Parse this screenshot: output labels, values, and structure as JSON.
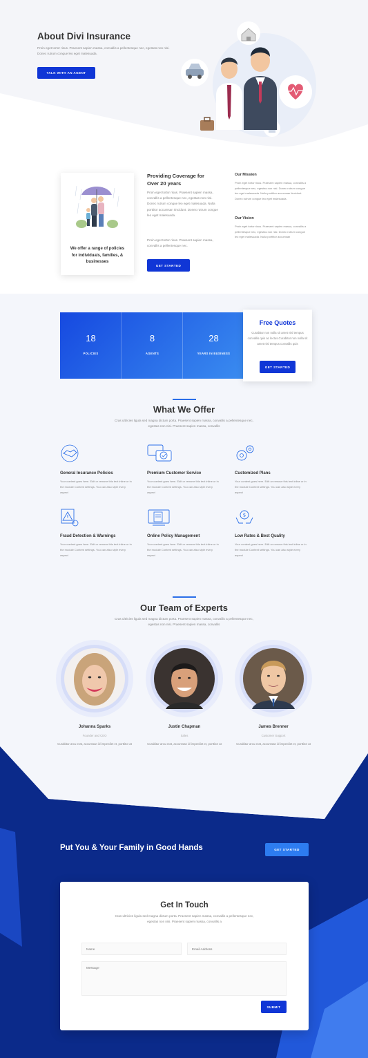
{
  "hero": {
    "title": "About Divi Insurance",
    "text": "Proin eget tortor risus. Praesent sapien massa, convallis a pellentesque nec, egestas non nisi. Donec rutrum congue leo eget malesuada.",
    "cta": "TALK WITH AN AGENT"
  },
  "coverage": {
    "card_text": "We offer a range of policies for individuals, families, & businesses",
    "title": "Providing Coverage for Over 20 years",
    "para1": "Proin eget tortor risus. Praesent sapien massa, convallis a pellentesque nec, egestas non nisi. Donec rutrum congue leo eget malesuada. Nulla porttitor accumsan tincidunt. Donec rutrum congue leo eget malesuada.",
    "para2": "Proin eget tortor risus. Praesent sapien massa, convallis a pellentesque nec.",
    "cta": "GET STARTED",
    "mission_title": "Our Mission",
    "mission_text": "Proin eget tortor risus. Praesent sapien massa, convallis a pellentesque nec, egestas non nisi. Donec rutrum congue leo eget malesuada. Nulla porttitor accumsan tincidunt. Donec rutrum congue leo eget malesuada.",
    "vision_title": "Our Vision",
    "vision_text": "Proin eget tortor risus. Praesent sapien massa, convallis a pellentesque nec, egestas non nisi. Donec rutrum congue leo eget malesuada. Nulla porttitor accumsan"
  },
  "stats": [
    {
      "value": "18",
      "label": "POLICIES"
    },
    {
      "value": "8",
      "label": "AGENTS"
    },
    {
      "value": "28",
      "label": "YEARS IN BUSINESS"
    }
  ],
  "quotes": {
    "title": "Free Quotes",
    "text": "Curabitur non nulla sit amet nisl tempus convallis quis ac lectus.Curabitur non nulla sit amet nisl tempus convallis quis",
    "cta": "GET STARTED"
  },
  "offer": {
    "title": "What We Offer",
    "subtitle": "Cras ultricies ligula sed magna dictum porta. Praesent sapien massa, convallis a pellentesque nec, egestas non nisi. Praesent sapien massa, convallis",
    "items": [
      {
        "title": "General Insurance Policies",
        "text": "Your content goes here. Edit or remove this text inline or in the module Content settings. You can also style every aspect",
        "icon": "handshake-icon"
      },
      {
        "title": "Premium Customer Service",
        "text": "Your content goes here. Edit or remove this text inline or in the module Content settings. You can also style every aspect",
        "icon": "chat-icon"
      },
      {
        "title": "Customized Plans",
        "text": "Your content goes here. Edit or remove this text inline or in the module Content settings. You can also style every aspect",
        "icon": "gears-icon"
      },
      {
        "title": "Fraud Detection & Warnings",
        "text": "Your content goes here. Edit or remove this text inline or in the module Content settings. You can also style every aspect",
        "icon": "warning-icon"
      },
      {
        "title": "Online Policy Management",
        "text": "Your content goes here. Edit or remove this text inline or in the module Content settings. You can also style every aspect",
        "icon": "monitor-icon"
      },
      {
        "title": "Low Rates & Best Quality",
        "text": "Your content goes here. Edit or remove this text inline or in the module Content settings. You can also style every aspect",
        "icon": "money-hands-icon"
      }
    ]
  },
  "team": {
    "title": "Our Team of Experts",
    "subtitle": "Cras ultricies ligula sed magna dictum porta. Praesent sapien massa, convallis a pellentesque nec, egestas non nisi. Praesent sapien massa, convallis",
    "members": [
      {
        "name": "Johanna Sparks",
        "role": "Founder and CEO",
        "bio": "Curabitur arcu erat, accumsan id imperdiet et, porttitor at sem. Donec rutrum congue leo eget malesuada. Nulla quis lorem"
      },
      {
        "name": "Justin Chapman",
        "role": "Sales",
        "bio": "Curabitur arcu erat, accumsan id imperdiet et, porttitor at sem. Donec rutrum congue leo eget malesuada. Nulla quis lorem"
      },
      {
        "name": "James Brenner",
        "role": "Customer Support",
        "bio": "Curabitur arcu erat, accumsan id imperdiet et, porttitor at sem. Donec rutrum congue leo eget malesuada. Nulla quis lorem"
      }
    ]
  },
  "family": {
    "title": "Put You & Your Family in Good Hands",
    "cta": "GET STARTED"
  },
  "contact": {
    "title": "Get In Touch",
    "subtitle": "Cras ultricies ligula sed magna dictum porta. Praesent sapien massa, convallis a pellentesque nec, egestas non nisi. Praesent sapien massa, convallis a",
    "name_placeholder": "Name",
    "email_placeholder": "Email Address",
    "message_placeholder": "Message",
    "submit": "SUBMIT"
  },
  "colors": {
    "primary": "#1036d6",
    "navy": "#0b2a8a",
    "accent": "#2a6ee8"
  }
}
